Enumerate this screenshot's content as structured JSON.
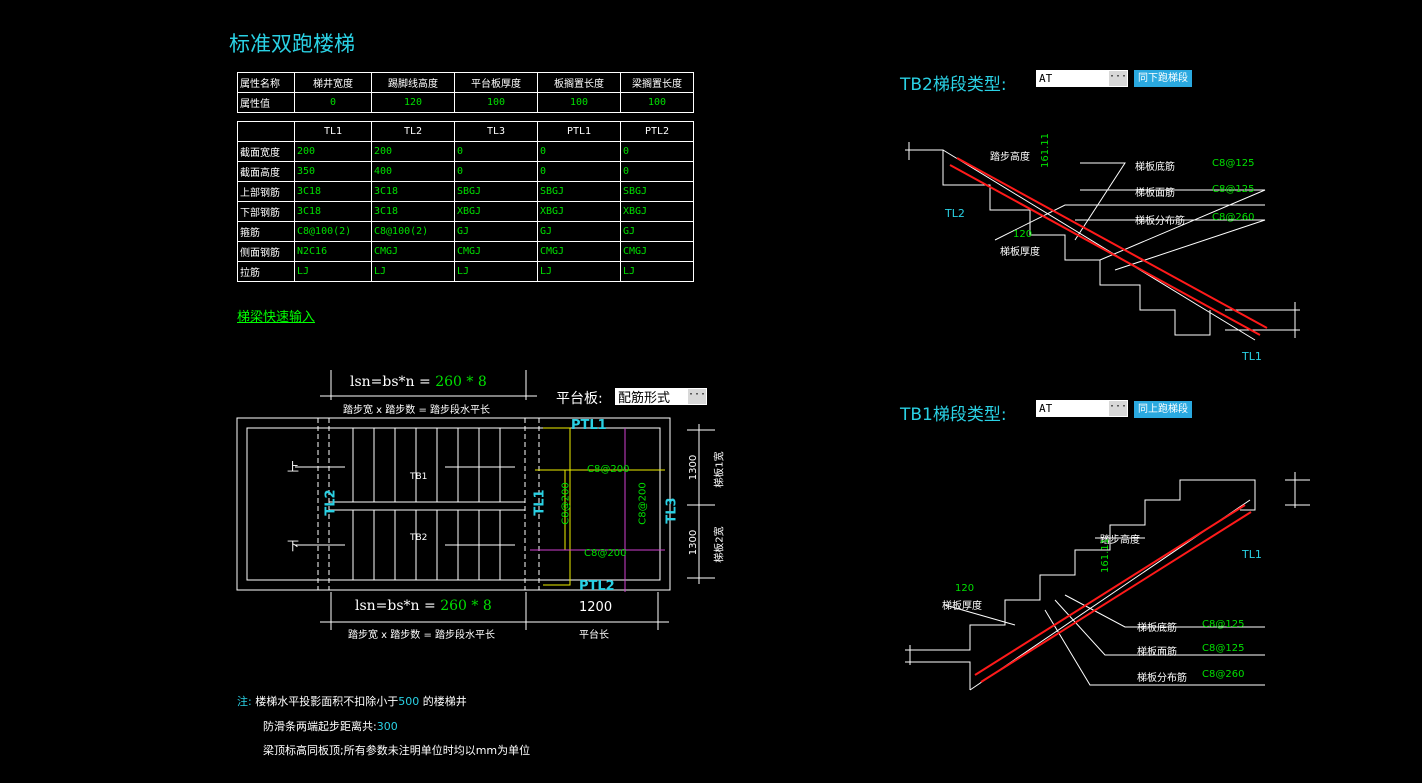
{
  "page_title": "标准双跑楼梯",
  "attr_table": {
    "headers": [
      "属性名称",
      "梯井宽度",
      "踢脚线高度",
      "平台板厚度",
      "板搁置长度",
      "梁搁置长度"
    ],
    "row_label": "属性值",
    "values": [
      "0",
      "120",
      "100",
      "100",
      "100"
    ]
  },
  "beam_table": {
    "columns": [
      "TL1",
      "TL2",
      "TL3",
      "PTL1",
      "PTL2"
    ],
    "rows": [
      {
        "label": "截面宽度",
        "cells": [
          "200",
          "200",
          "0",
          "0",
          "0"
        ]
      },
      {
        "label": "截面高度",
        "cells": [
          "350",
          "400",
          "0",
          "0",
          "0"
        ]
      },
      {
        "label": "上部钢筋",
        "cells": [
          "3C18",
          "3C18",
          "SBGJ",
          "SBGJ",
          "SBGJ"
        ]
      },
      {
        "label": "下部钢筋",
        "cells": [
          "3C18",
          "3C18",
          "XBGJ",
          "XBGJ",
          "XBGJ"
        ]
      },
      {
        "label": "箍筋",
        "cells": [
          "C8@100(2)",
          "C8@100(2)",
          "GJ",
          "GJ",
          "GJ"
        ]
      },
      {
        "label": "侧面钢筋",
        "cells": [
          "N2C16",
          "CMGJ",
          "CMGJ",
          "CMGJ",
          "CMGJ"
        ]
      },
      {
        "label": "拉筋",
        "cells": [
          "LJ",
          "LJ",
          "LJ",
          "LJ",
          "LJ"
        ]
      }
    ]
  },
  "quick_input_link": "梯梁快速输入",
  "plan": {
    "formula_prefix": "lsn=bs*n =",
    "formula_values": "260 * 8",
    "formula_caption": "踏步宽 x 踏步数 = 踏步段水平长",
    "platform_label": "平台板:",
    "platform_value": "配筋形式",
    "labels": {
      "up": "上",
      "down": "下",
      "tb1": "TB1",
      "tb2": "TB2",
      "tl1": "TL1",
      "tl2": "TL2",
      "tl3": "TL3",
      "ptl1": "PTL1",
      "ptl2": "PTL2",
      "rebar": "C8@200",
      "w1": "1300",
      "w2": "1300",
      "w1_label": "梯板1宽",
      "w2_label": "梯板2宽",
      "platform_len": "1200",
      "platform_len_label": "平台长"
    }
  },
  "tb2": {
    "label": "TB2梯段类型:",
    "type_value": "AT",
    "button": "同下跑梯段",
    "labels": {
      "step_height": "踏步高度",
      "step_val": "161.11",
      "bottom_rebar": "梯板底筋",
      "bottom_val": "C8@125",
      "top_rebar": "梯板面筋",
      "top_val": "C8@125",
      "dist_rebar": "梯板分布筋",
      "dist_val": "C8@260",
      "thickness_val": "120",
      "thickness": "梯板厚度",
      "tl2": "TL2",
      "tl1": "TL1"
    }
  },
  "tb1": {
    "label": "TB1梯段类型:",
    "type_value": "AT",
    "button": "同上跑梯段",
    "labels": {
      "step_height": "踏步高度",
      "step_val": "161.11",
      "bottom_rebar": "梯板底筋",
      "bottom_val": "C8@125",
      "top_rebar": "梯板面筋",
      "top_val": "C8@125",
      "dist_rebar": "梯板分布筋",
      "dist_val": "C8@260",
      "thickness_val": "120",
      "thickness": "梯板厚度",
      "tl1": "TL1"
    }
  },
  "notes": {
    "prefix": "注:",
    "line1_a": "楼梯水平投影面积不扣除小于",
    "line1_num": "500",
    "line1_b": "的楼梯井",
    "line2_a": "防滑条两端起步距离共:",
    "line2_num": "300",
    "line3": "梁顶标高同板顶;所有参数未注明单位时均以mm为单位"
  },
  "colors": {
    "cyan": "#2ad1e4",
    "green": "#00e000",
    "red": "#ff1a1a",
    "yellow": "#f0f000",
    "magenta": "#d040d0",
    "button": "#2aa9e0"
  }
}
